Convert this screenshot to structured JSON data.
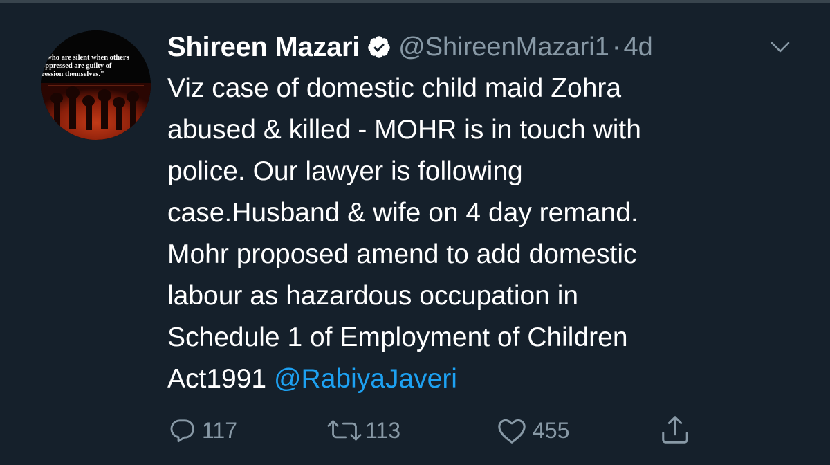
{
  "author": {
    "display_name": "Shireen Mazari",
    "handle": "@ShireenMazari1",
    "separator": "·",
    "timestamp": "4d",
    "verified": true,
    "avatar_quote_lines": [
      "e who are silent when others",
      "oppressed are guilty of",
      "ression themselves.\""
    ]
  },
  "tweet": {
    "lines": [
      "Viz case of domestic child maid Zohra",
      "abused & killed - MOHR is in touch with",
      "police. Our lawyer is following",
      "case.Husband & wife on 4 day remand.",
      "Mohr proposed amend to add domestic",
      "labour as hazardous occupation in",
      "Schedule 1 of Employment of Children"
    ],
    "last_line_text": "Act1991 ",
    "mention": "@RabiyaJaveri"
  },
  "actions": {
    "reply_count": "117",
    "retweet_count": "113",
    "like_count": "455"
  },
  "icons": {
    "verified": "verified-badge-icon",
    "menu": "chevron-down-icon",
    "reply": "reply-icon",
    "retweet": "retweet-icon",
    "like": "heart-icon",
    "share": "share-icon"
  },
  "colors": {
    "background": "#15202b",
    "text": "#ffffff",
    "secondary": "#8899a6",
    "link": "#1da1f2"
  }
}
